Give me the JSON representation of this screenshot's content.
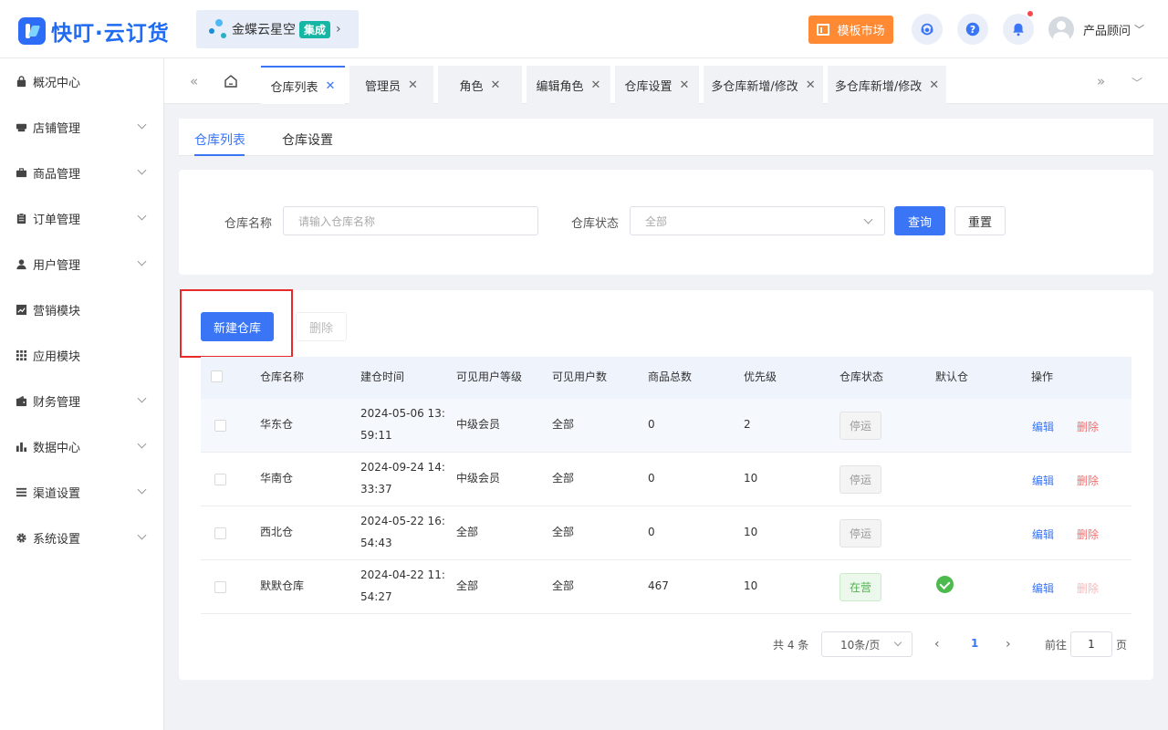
{
  "header": {
    "brand": "快叮·云订货",
    "integration": {
      "name": "金蝶云星空",
      "tag": "集成"
    },
    "template_market": "模板市场",
    "user_name": "产品顾问",
    "colors": {
      "primary": "#3a75f5",
      "orange": "#ff8a33",
      "badge": "#16b6a5"
    }
  },
  "sidebar": {
    "items": [
      {
        "label": "概况中心",
        "icon": "bag-icon"
      },
      {
        "label": "店铺管理",
        "icon": "shop-icon"
      },
      {
        "label": "商品管理",
        "icon": "briefcase-icon"
      },
      {
        "label": "订单管理",
        "icon": "clipboard-icon"
      },
      {
        "label": "用户管理",
        "icon": "user-icon"
      },
      {
        "label": "营销模块",
        "icon": "trend-chart-icon"
      },
      {
        "label": "应用模块",
        "icon": "grid-icon"
      },
      {
        "label": "财务管理",
        "icon": "wallet-icon"
      },
      {
        "label": "数据中心",
        "icon": "bar-chart-icon"
      },
      {
        "label": "渠道设置",
        "icon": "list-icon"
      },
      {
        "label": "系统设置",
        "icon": "gear-icon"
      }
    ]
  },
  "tabs": [
    {
      "label": "仓库列表"
    },
    {
      "label": "管理员"
    },
    {
      "label": "角色"
    },
    {
      "label": "编辑角色"
    },
    {
      "label": "仓库设置"
    },
    {
      "label": "多仓库新增/修改"
    },
    {
      "label": "多仓库新增/修改"
    }
  ],
  "sub_tabs": [
    "仓库列表",
    "仓库设置"
  ],
  "filter": {
    "name_label": "仓库名称",
    "name_placeholder": "请输入仓库名称",
    "status_label": "仓库状态",
    "status_value": "全部",
    "query": "查询",
    "reset": "重置"
  },
  "actions": {
    "create": "新建仓库",
    "delete": "删除"
  },
  "table": {
    "headers": [
      "仓库名称",
      "建仓时间",
      "可见用户等级",
      "可见用户数",
      "商品总数",
      "优先级",
      "仓库状态",
      "默认仓",
      "操作"
    ],
    "rows": [
      {
        "name": "华东仓",
        "date": "2024-05-06 13:",
        "time": "59:11",
        "level": "中级会员",
        "users": "全部",
        "goods": "0",
        "priority": "2",
        "status": "停运",
        "default": false,
        "edit": "编辑",
        "del": "删除"
      },
      {
        "name": "华南仓",
        "date": "2024-09-24 14:",
        "time": "33:37",
        "level": "中级会员",
        "users": "全部",
        "goods": "0",
        "priority": "10",
        "status": "停运",
        "default": false,
        "edit": "编辑",
        "del": "删除"
      },
      {
        "name": "西北仓",
        "date": "2024-05-22 16:",
        "time": "54:43",
        "level": "全部",
        "users": "全部",
        "goods": "0",
        "priority": "10",
        "status": "停运",
        "default": false,
        "edit": "编辑",
        "del": "删除"
      },
      {
        "name": "默默仓库",
        "date": "2024-04-22 11:",
        "time": "54:27",
        "level": "全部",
        "users": "全部",
        "goods": "467",
        "priority": "10",
        "status": "在营",
        "default": true,
        "edit": "编辑",
        "del": "删除"
      }
    ]
  },
  "pagination": {
    "total": "共 4 条",
    "page_size": "10条/页",
    "current": "1",
    "goto_label": "前往",
    "goto_value": "1",
    "page_suffix": "页"
  }
}
